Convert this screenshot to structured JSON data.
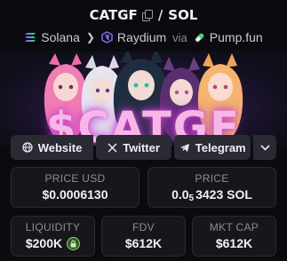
{
  "pair": {
    "base": "CATGF",
    "separator": "/",
    "quote": "SOL"
  },
  "route": {
    "chain": "Solana",
    "dex": "Raydium",
    "via": "via",
    "launchpad": "Pump.fun"
  },
  "banner": {
    "title": "$CATGF"
  },
  "links": {
    "website": "Website",
    "twitter": "Twitter",
    "telegram": "Telegram"
  },
  "stats": {
    "price_usd": {
      "label": "PRICE USD",
      "value": "$0.0006130"
    },
    "price": {
      "label": "PRICE",
      "value_prefix": "0.0",
      "value_zeros": "5",
      "value_rest": "3423 SOL"
    },
    "liquidity": {
      "label": "LIQUIDITY",
      "value": "$200K"
    },
    "fdv": {
      "label": "FDV",
      "value": "$612K"
    },
    "mkt_cap": {
      "label": "MKT CAP",
      "value": "$612K"
    }
  },
  "colors": {
    "background": "#0b0b0f",
    "card": "#16161c",
    "accent_pink": "#e24bd1",
    "lock_green": "#8fdc5a"
  }
}
